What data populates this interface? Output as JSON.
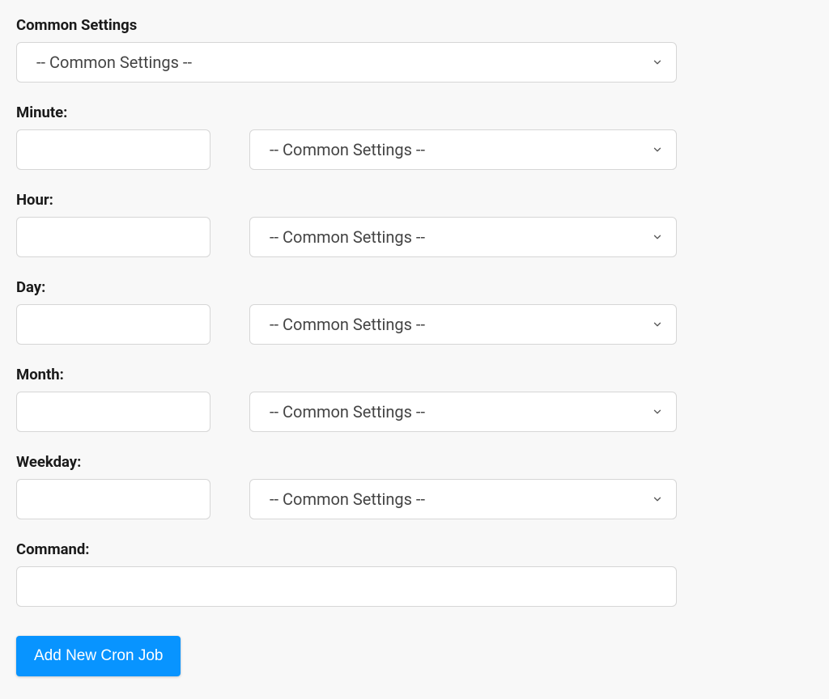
{
  "common_settings": {
    "label": "Common Settings",
    "select_text": "-- Common Settings --"
  },
  "fields": {
    "minute": {
      "label": "Minute:",
      "value": "",
      "select_text": "-- Common Settings --"
    },
    "hour": {
      "label": "Hour:",
      "value": "",
      "select_text": "-- Common Settings --"
    },
    "day": {
      "label": "Day:",
      "value": "",
      "select_text": "-- Common Settings --"
    },
    "month": {
      "label": "Month:",
      "value": "",
      "select_text": "-- Common Settings --"
    },
    "weekday": {
      "label": "Weekday:",
      "value": "",
      "select_text": "-- Common Settings --"
    }
  },
  "command": {
    "label": "Command:",
    "value": ""
  },
  "submit_label": "Add New Cron Job"
}
